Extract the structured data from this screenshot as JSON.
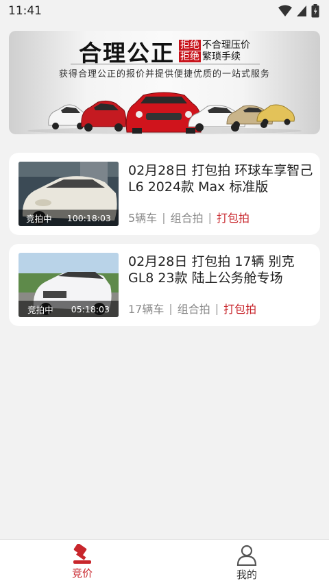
{
  "status_bar": {
    "time": "11:41"
  },
  "banner": {
    "title": "合理公正",
    "line1_tag": "拒绝",
    "line1_text": "不合理压价",
    "line2_tag": "拒绝",
    "line2_text": "繁琐手续",
    "subtitle": "获得合理公正的报价并提供便捷优质的一站式服务"
  },
  "auctions": [
    {
      "title": "02月28日 打包拍 环球车享智己L6 2024款 Max 标准版",
      "status": "竞拍中",
      "countdown": "100:18:03",
      "count": "5辆车",
      "mode": "组合拍",
      "package": "打包拍",
      "car_color": "#e9e6dc"
    },
    {
      "title": "02月28日 打包拍 17辆 别克GL8 23款 陆上公务舱专场",
      "status": "竞拍中",
      "countdown": "05:18:03",
      "count": "17辆车",
      "mode": "组合拍",
      "package": "打包拍",
      "car_color": "#f4f4f6"
    }
  ],
  "tabbar": {
    "tabs": [
      {
        "label": "竞价",
        "icon": "gavel-icon",
        "active": true
      },
      {
        "label": "我的",
        "icon": "person-icon",
        "active": false
      }
    ]
  },
  "colors": {
    "accent": "#c8262c",
    "background": "#f2f2f2"
  }
}
